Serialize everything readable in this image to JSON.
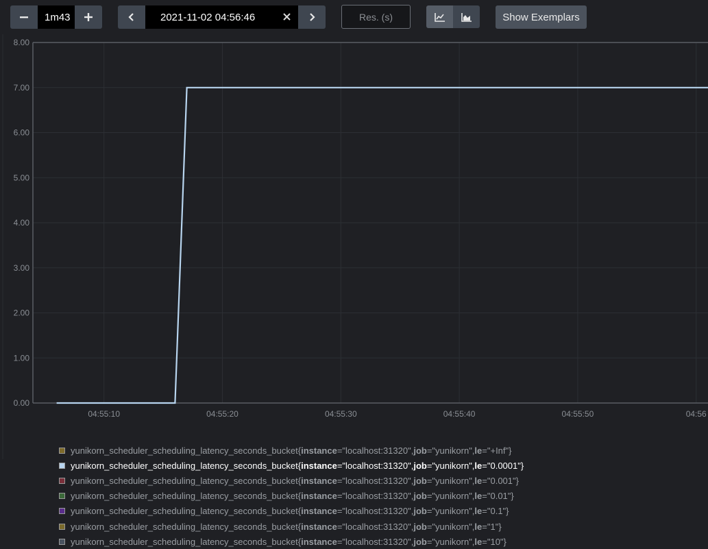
{
  "toolbar": {
    "range_value": "1m43",
    "end_time": "2021-11-02 04:56:46",
    "resolution_placeholder": "Res. (s)",
    "show_exemplars_label": "Show Exemplars"
  },
  "colors": {
    "background": "#1f2024",
    "grid": "#2c2f34",
    "axis": "#5a5e64",
    "selected_series": "#b8d5ef"
  },
  "chart_data": {
    "type": "line",
    "ylim": [
      0,
      8
    ],
    "yticks": [
      "0.00",
      "1.00",
      "2.00",
      "3.00",
      "4.00",
      "5.00",
      "6.00",
      "7.00",
      "8.00"
    ],
    "xlim": [
      "04:55:04",
      "04:56:01"
    ],
    "xticks": [
      "04:55:10",
      "04:55:20",
      "04:55:30",
      "04:55:40",
      "04:55:50",
      "04:56"
    ],
    "grid": true,
    "series": [
      {
        "name": "yunikorn_scheduler_scheduling_latency_seconds_bucket{instance=\"localhost:31320\", job=\"yunikorn\", le=\"0.0001\"}",
        "x": [
          "04:55:06",
          "04:55:16",
          "04:55:17",
          "04:56:01"
        ],
        "y": [
          0,
          0,
          7,
          7
        ]
      }
    ]
  },
  "legend": [
    {
      "metric": "yunikorn_scheduler_scheduling_latency_seconds_bucket",
      "open": "{",
      "k1": "instance",
      "v1": "=\"localhost:31320\", ",
      "k2": "job",
      "v2": "=\"yunikorn\", ",
      "k3": "le",
      "v3": "=\"+Inf\"}",
      "color": "#7d6a2a"
    },
    {
      "metric": "yunikorn_scheduler_scheduling_latency_seconds_bucket",
      "open": "{",
      "k1": "instance",
      "v1": "=\"localhost:31320\", ",
      "k2": "job",
      "v2": "=\"yunikorn\", ",
      "k3": "le",
      "v3": "=\"0.0001\"}",
      "color": "#b8d5ef"
    },
    {
      "metric": "yunikorn_scheduler_scheduling_latency_seconds_bucket",
      "open": "{",
      "k1": "instance",
      "v1": "=\"localhost:31320\", ",
      "k2": "job",
      "v2": "=\"yunikorn\", ",
      "k3": "le",
      "v3": "=\"0.001\"}",
      "color": "#7a2f3a"
    },
    {
      "metric": "yunikorn_scheduler_scheduling_latency_seconds_bucket",
      "open": "{",
      "k1": "instance",
      "v1": "=\"localhost:31320\", ",
      "k2": "job",
      "v2": "=\"yunikorn\", ",
      "k3": "le",
      "v3": "=\"0.01\"}",
      "color": "#3c6a3a"
    },
    {
      "metric": "yunikorn_scheduler_scheduling_latency_seconds_bucket",
      "open": "{",
      "k1": "instance",
      "v1": "=\"localhost:31320\", ",
      "k2": "job",
      "v2": "=\"yunikorn\", ",
      "k3": "le",
      "v3": "=\"0.1\"}",
      "color": "#5a2d8c"
    },
    {
      "metric": "yunikorn_scheduler_scheduling_latency_seconds_bucket",
      "open": "{",
      "k1": "instance",
      "v1": "=\"localhost:31320\", ",
      "k2": "job",
      "v2": "=\"yunikorn\", ",
      "k3": "le",
      "v3": "=\"1\"}",
      "color": "#7a6a2c"
    },
    {
      "metric": "yunikorn_scheduler_scheduling_latency_seconds_bucket",
      "open": "{",
      "k1": "instance",
      "v1": "=\"localhost:31320\", ",
      "k2": "job",
      "v2": "=\"yunikorn\", ",
      "k3": "le",
      "v3": "=\"10\"}",
      "color": "#4a5360"
    }
  ]
}
